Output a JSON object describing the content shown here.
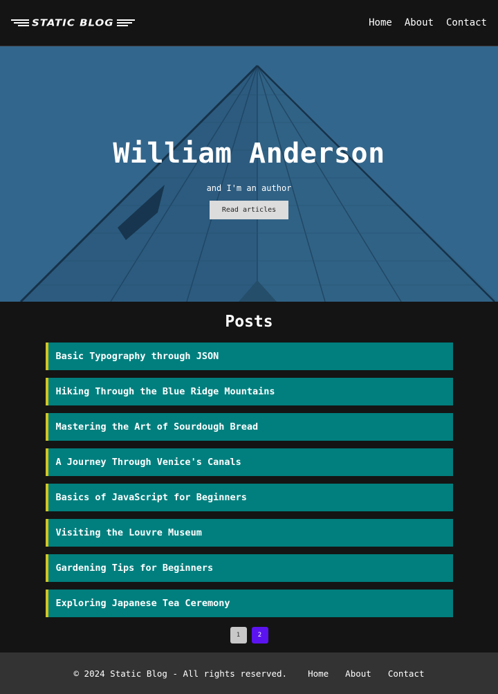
{
  "header": {
    "logo_text": "STATIC BLOG",
    "nav": [
      "Home",
      "About",
      "Contact"
    ]
  },
  "hero": {
    "title": "William Anderson",
    "subtitle": "and I'm an author",
    "button_label": "Read articles",
    "background_image": "glass-building-icon"
  },
  "posts": {
    "title": "Posts",
    "items": [
      "Basic Typography through JSON",
      "Hiking Through the Blue Ridge Mountains",
      "Mastering the Art of Sourdough Bread",
      "A Journey Through Venice's Canals",
      "Basics of JavaScript for Beginners",
      "Visiting the Louvre Museum",
      "Gardening Tips for Beginners",
      "Exploring Japanese Tea Ceremony"
    ]
  },
  "pagination": {
    "pages": [
      "1",
      "2"
    ],
    "current": "2"
  },
  "footer": {
    "copyright": "© 2024 Static Blog - All rights reserved.",
    "nav": [
      "Home",
      "About",
      "Contact"
    ]
  },
  "colors": {
    "post_bg": "#007f7e",
    "post_accent": "#d6c41e",
    "active_page": "#5b14f0",
    "hero_tint": "#2f5f82"
  }
}
